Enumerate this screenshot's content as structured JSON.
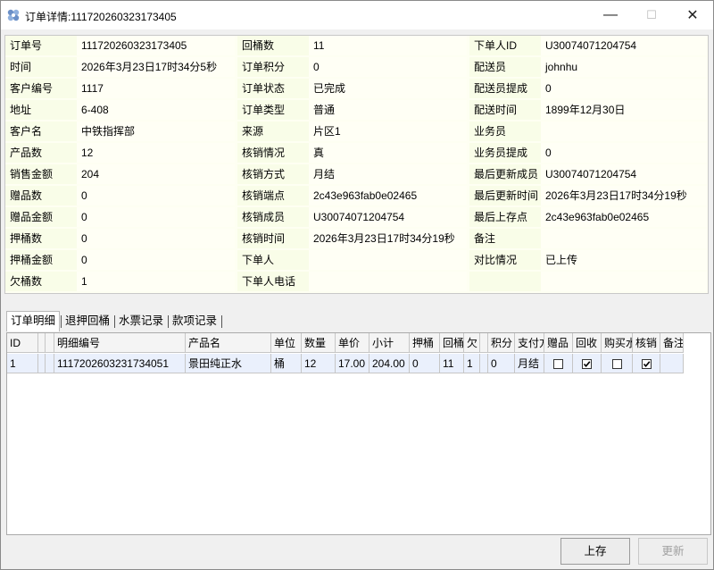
{
  "window": {
    "title": "订单详情:111720260323173405",
    "controls": {
      "minimize": "—",
      "maximize": "☐",
      "close": "✕"
    },
    "icon": "app-icon"
  },
  "info": {
    "rows": [
      [
        "订单号",
        "111720260323173405",
        "回桶数",
        "11",
        "下单人ID",
        "U30074071204754"
      ],
      [
        "时间",
        "2026年3月23日17时34分5秒",
        "订单积分",
        "0",
        "配送员",
        "johnhu"
      ],
      [
        "客户编号",
        "1117",
        "订单状态",
        "已完成",
        "配送员提成",
        "0"
      ],
      [
        "地址",
        "6-408",
        "订单类型",
        "普通",
        "配送时间",
        "1899年12月30日"
      ],
      [
        "客户名",
        "中铁指挥部",
        "来源",
        "片区1",
        "业务员",
        ""
      ],
      [
        "产品数",
        "12",
        "核销情况",
        "真",
        "业务员提成",
        "0"
      ],
      [
        "销售金额",
        "204",
        "核销方式",
        "月结",
        "最后更新成员",
        "U30074071204754"
      ],
      [
        "赠品数",
        "0",
        "核销端点",
        "2c43e963fab0e02465",
        "最后更新时间",
        "2026年3月23日17时34分19秒"
      ],
      [
        "赠品金额",
        "0",
        "核销成员",
        "U30074071204754",
        "最后上存点",
        "2c43e963fab0e02465"
      ],
      [
        "押桶数",
        "0",
        "核销时间",
        "2026年3月23日17时34分19秒",
        "备注",
        ""
      ],
      [
        "押桶金额",
        "0",
        "下单人",
        "",
        "对比情况",
        "已上传"
      ],
      [
        "欠桶数",
        "1",
        "下单人电话",
        "",
        "",
        ""
      ]
    ]
  },
  "tabs": [
    "订单明细",
    "退押回桶",
    "水票记录",
    "款项记录"
  ],
  "grid": {
    "columns": [
      "ID",
      "",
      "",
      "明细编号",
      "产品名",
      "单位",
      "数量",
      "单价",
      "小计",
      "押桶",
      "回桶",
      "欠",
      "",
      "积分",
      "支付方",
      "赠品",
      "回收",
      "购买水",
      "核销",
      "备注"
    ],
    "rows": [
      {
        "id": "1",
        "detail_no": "1117202603231734051",
        "product": "景田纯正水",
        "unit": "桶",
        "qty": "12",
        "price": "17.00",
        "subtotal": "204.00",
        "deposit": "0",
        "returned": "11",
        "owed": "1",
        "points": "0",
        "payment": "月结",
        "gift": false,
        "recycle": true,
        "buy_water": false,
        "verified": true
      }
    ]
  },
  "buttons": {
    "upload": "上存",
    "update": "更新"
  }
}
